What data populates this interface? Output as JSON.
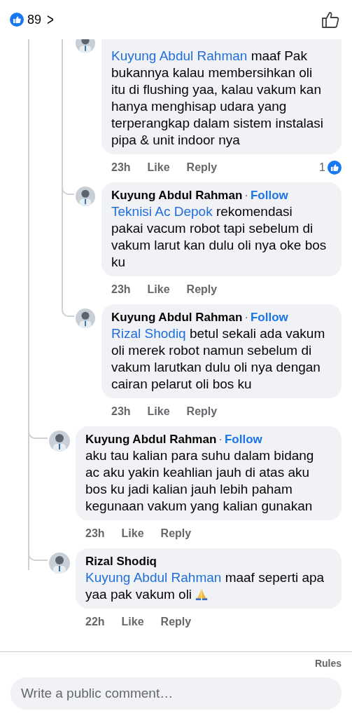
{
  "header": {
    "reaction_count": "89",
    "chevron": ">"
  },
  "deep_replies": [
    {
      "kind": "cut",
      "mention": "Kuyung Abdul Rahman",
      "text": "maaf Pak bukannya kalau membersihkan oli itu di flushing yaa, kalau vakum kan hanya menghisap udara yang terperangkap dalam sistem instalasi pipa & unit indoor nya",
      "time": "23h",
      "like": "Like",
      "reply": "Reply",
      "reactions": "1"
    },
    {
      "kind": "plain",
      "author": "Kuyung Abdul Rahman",
      "separator": "·",
      "follow": "Follow",
      "mention": "Teknisi Ac Depok",
      "text": " rekomendasi pakai vacum robot tapi sebelum di vakum larut kan dulu oli nya oke bos ku",
      "time": "23h",
      "like": "Like",
      "reply": "Reply"
    },
    {
      "kind": "plain",
      "author": "Kuyung Abdul Rahman",
      "separator": "·",
      "follow": "Follow",
      "mention": "Rizal Shodiq",
      "text": " betul sekali ada vakum oli merek robot namun sebelum di vakum larutkan dulu oli nya dengan cairan pelarut oli  bos ku",
      "time": "23h",
      "like": "Like",
      "reply": "Reply"
    }
  ],
  "replies": [
    {
      "kind": "plain",
      "author": "Kuyung Abdul Rahman",
      "separator": "·",
      "follow": "Follow",
      "text": "aku tau kalian para suhu dalam bidang ac aku yakin keahlian jauh di atas aku bos ku jadi kalian jauh lebih paham kegunaan vakum yang kalian gunakan",
      "time": "23h",
      "like": "Like",
      "reply": "Reply"
    },
    {
      "kind": "emoji",
      "author": "Rizal Shodiq",
      "mention": "Kuyung Abdul Rahman",
      "text": "maaf seperti apa yaa pak vakum oli",
      "time": "22h",
      "like": "Like",
      "reply": "Reply"
    }
  ],
  "footer": {
    "rules": "Rules",
    "placeholder": "Write a public comment…"
  }
}
